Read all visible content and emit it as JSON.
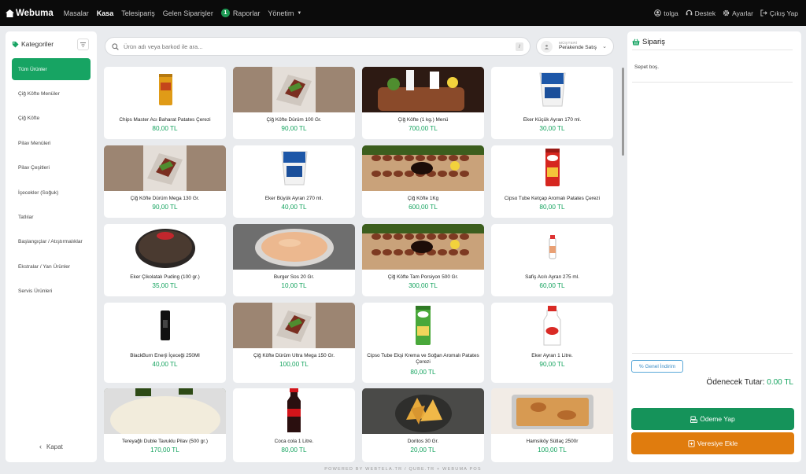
{
  "nav": {
    "brand": "Webuma",
    "links": [
      {
        "label": "Masalar",
        "active": false
      },
      {
        "label": "Kasa",
        "active": true
      },
      {
        "label": "Telesipariş",
        "active": false
      },
      {
        "label": "Gelen Siparişler",
        "active": false
      },
      {
        "label": "Raporlar",
        "active": false,
        "badge": "1"
      },
      {
        "label": "Yönetim",
        "active": false,
        "dropdown": true
      }
    ],
    "right": {
      "user": "tolga",
      "support": "Destek",
      "settings": "Ayarlar",
      "logout": "Çıkış Yap"
    }
  },
  "sidebar": {
    "title": "Kategoriler",
    "collapse_label": "Kapat",
    "items": [
      {
        "label": "Tüm Ürünler",
        "active": true
      },
      {
        "label": "Çiğ Köfte Menüler"
      },
      {
        "label": "Çiğ Köfte"
      },
      {
        "label": "Pilav Menüleri"
      },
      {
        "label": "Pilav Çeşitleri"
      },
      {
        "label": "İçecekler (Soğuk)"
      },
      {
        "label": "Tatlılar"
      },
      {
        "label": "Başlangıçlar / Atıştırmalıklar"
      },
      {
        "label": "Ekstralar / Yan Ürünler"
      },
      {
        "label": "Servis Ürünleri"
      }
    ]
  },
  "search": {
    "placeholder": "Ürün adı veya barkod ile ara...",
    "shortcut": "/"
  },
  "customer": {
    "label": "MÜŞTERİ",
    "value": "Perakende Satış"
  },
  "products": [
    {
      "name": "Chips Master Acı Baharat Patates Çerezi",
      "price": "80,00 TL",
      "img": "can-orange"
    },
    {
      "name": "Çiğ Köfte Dürüm 100 Gr.",
      "price": "90,00 TL",
      "img": "wrap"
    },
    {
      "name": "Çiğ Köfte (1 kg.) Menü",
      "price": "700,00 TL",
      "img": "menu"
    },
    {
      "name": "Eker Küçük Ayran 170 ml.",
      "price": "30,00 TL",
      "img": "cup-blue"
    },
    {
      "name": "Çiğ Köfte Dürüm Mega 130 Gr.",
      "price": "90,00 TL",
      "img": "wrap"
    },
    {
      "name": "Eker Büyük Ayran 270 ml.",
      "price": "40,00 TL",
      "img": "cup-blue"
    },
    {
      "name": "Çiğ Köfte 1Kg",
      "price": "600,00 TL",
      "img": "kofte"
    },
    {
      "name": "Cipso Tube Ketçap Aromalı Patates Çerezi",
      "price": "80,00 TL",
      "img": "can-red"
    },
    {
      "name": "Eker Çikolatalı Puding (100 gr.)",
      "price": "35,00 TL",
      "img": "pudding"
    },
    {
      "name": "Burger Sos 20 Gr.",
      "price": "10,00 TL",
      "img": "sauce"
    },
    {
      "name": "Çiğ Köfte Tam Porsiyon 500 Gr.",
      "price": "300,00 TL",
      "img": "kofte"
    },
    {
      "name": "Safiş Acılı Ayran 275 ml.",
      "price": "60,00 TL",
      "img": "bottle-small"
    },
    {
      "name": "BlackBurn Enerji İçeceği 250Ml",
      "price": "40,00 TL",
      "img": "can-black"
    },
    {
      "name": "Çiğ Köfte Dürüm Ultra Mega 150 Gr.",
      "price": "100,00 TL",
      "img": "wrap"
    },
    {
      "name": "Cipso Tube Ekşi Krema ve Soğan Aromalı Patates Çerezi",
      "price": "80,00 TL",
      "img": "can-green"
    },
    {
      "name": "Eker Ayran 1 Litre.",
      "price": "90,00 TL",
      "img": "bottle-white"
    },
    {
      "name": "Tereyağlı Duble Tavuklu Pilav (500 gr.)",
      "price": "170,00 TL",
      "img": "rice"
    },
    {
      "name": "Coca cola 1 Litre.",
      "price": "80,00 TL",
      "img": "cola"
    },
    {
      "name": "Doritos 30 Gr.",
      "price": "20,00 TL",
      "img": "chips"
    },
    {
      "name": "Hamsiköy Sütlaç 2500r",
      "price": "100,00 TL",
      "img": "sutlac"
    }
  ],
  "order": {
    "title": "Sipariş",
    "empty": "Sepet boş.",
    "discount_label": "% Genel İndirim",
    "total_label": "Ödenecek Tutar:",
    "total_value": "0.00 TL",
    "pay_label": "Ödeme Yap",
    "credit_label": "Veresiye Ekle"
  },
  "footer": "POWERED BY WEBTELA.TR / QUBE.TR + WEBUMA POS",
  "colors": {
    "accent": "#17a463",
    "price": "#14a35e",
    "pay": "#15935a",
    "credit": "#e07c0e",
    "topnav": "#0b0b0b"
  }
}
